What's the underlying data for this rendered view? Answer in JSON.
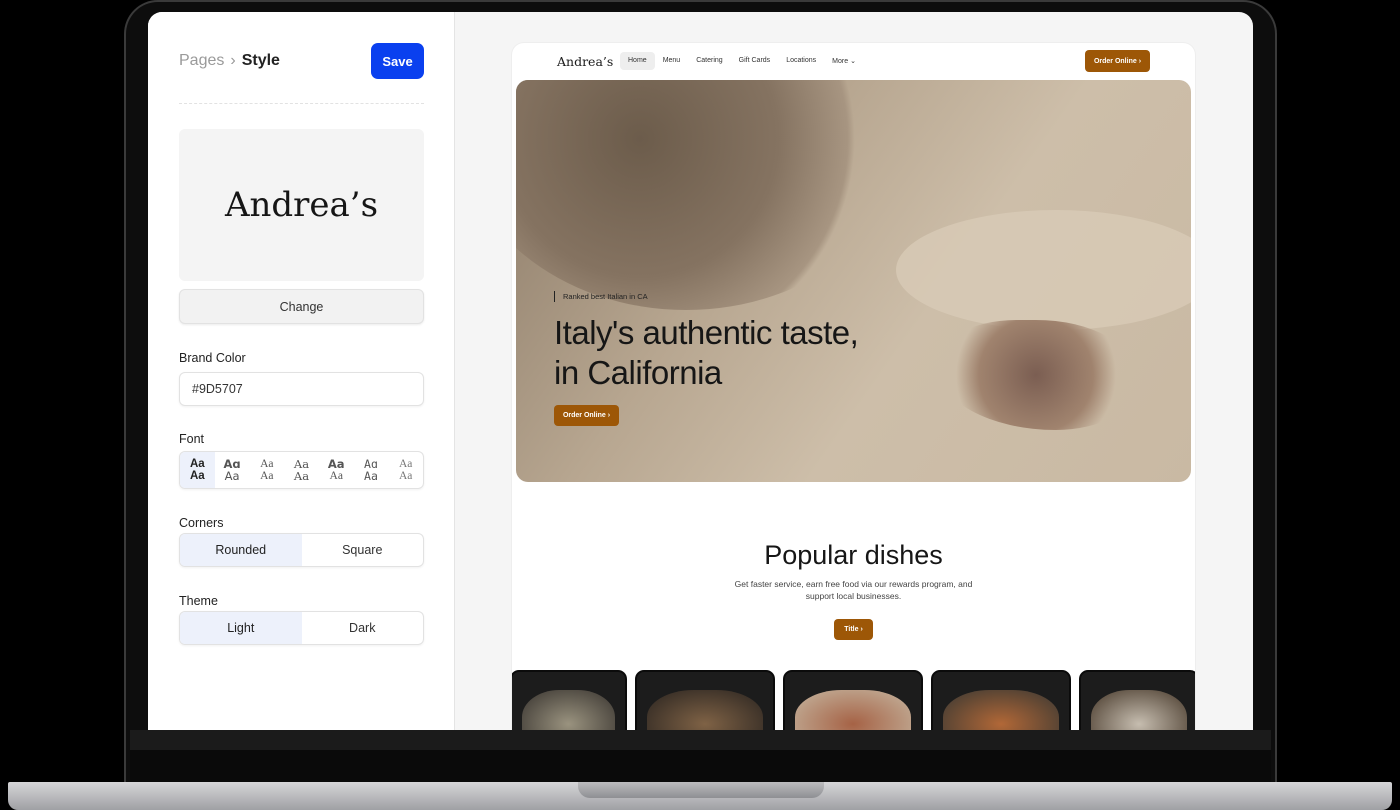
{
  "editor": {
    "breadcrumb": {
      "parent": "Pages",
      "current": "Style"
    },
    "save_label": "Save",
    "logo_text": "Andrea’s",
    "change_label": "Change",
    "brand_color": {
      "label": "Brand Color",
      "value": "#9D5707"
    },
    "font": {
      "label": "Font",
      "options": [
        {
          "top": "Aa",
          "bottom": "Aa"
        },
        {
          "top": "Aɑ",
          "bottom": "Aa"
        },
        {
          "top": "Aa",
          "bottom": "Aa"
        },
        {
          "top": "Aa",
          "bottom": "Aa"
        },
        {
          "top": "Aa",
          "bottom": "Aa"
        },
        {
          "top": "Aɑ",
          "bottom": "Aa"
        },
        {
          "top": "Aa",
          "bottom": "Aa"
        }
      ],
      "selected_index": 0
    },
    "corners": {
      "label": "Corners",
      "options": [
        "Rounded",
        "Square"
      ],
      "selected": "Rounded"
    },
    "theme": {
      "label": "Theme",
      "options": [
        "Light",
        "Dark"
      ],
      "selected": "Light"
    }
  },
  "preview": {
    "logo": "Andrea’s",
    "nav": [
      "Home",
      "Menu",
      "Catering",
      "Gift Cards",
      "Locations",
      "More"
    ],
    "active_nav": "Home",
    "order_label": "Order Online",
    "hero": {
      "badge": "Ranked best Italian in CA",
      "headline": "Italy's authentic taste, in California",
      "button": "Order Online"
    },
    "popular": {
      "title": "Popular dishes",
      "subtitle": "Get faster service, earn free food via our rewards program, and support local businesses.",
      "button": "Title"
    },
    "brand_color": "#9D5707"
  }
}
